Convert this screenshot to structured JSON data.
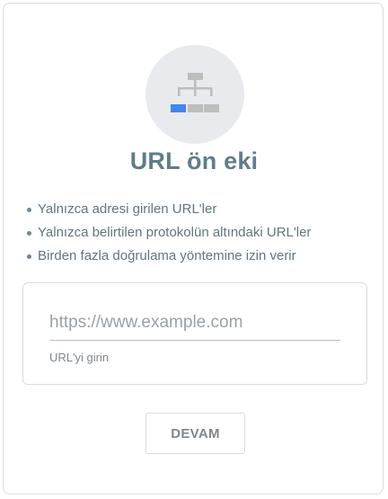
{
  "dialog": {
    "hero_icon": "sitemap-icon",
    "title": "URL ön eki",
    "features": [
      "Yalnızca adresi girilen URL'ler",
      "Yalnızca belirtilen protokolün altındaki URL'ler",
      "Birden fazla doğrulama yöntemine izin verir"
    ],
    "url_input": {
      "value": "",
      "placeholder": "https://www.example.com",
      "helper": "URL'yi girin"
    },
    "continue_label": "DEVAM"
  },
  "colors": {
    "accent": "#4285f4",
    "icon_gray": "#bdbdbd",
    "title": "#607d8b",
    "hero_bg": "#e8eaed"
  }
}
